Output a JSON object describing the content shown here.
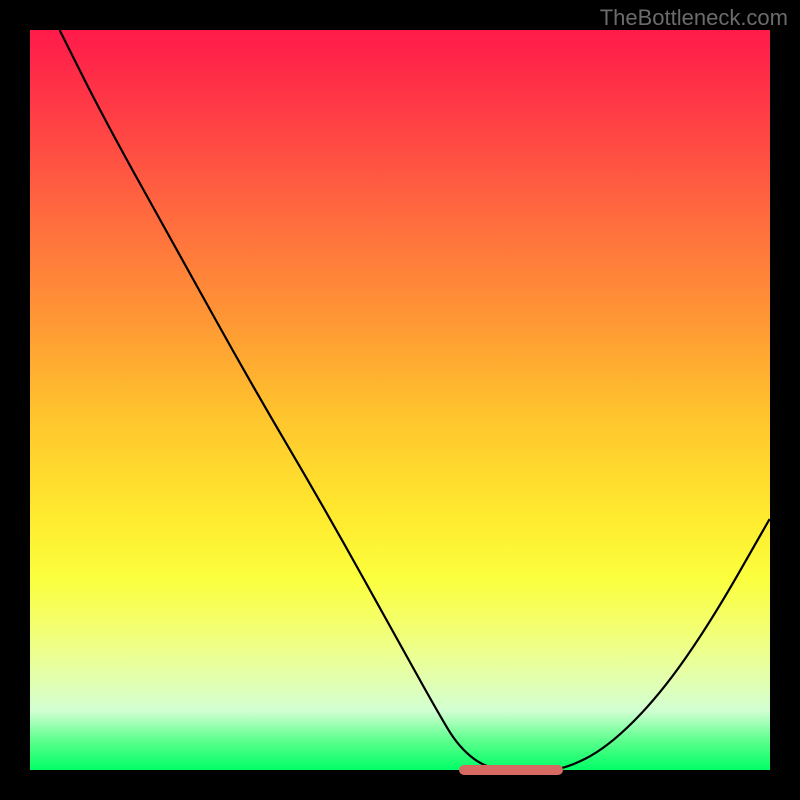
{
  "watermark": "TheBottleneck.com",
  "chart_data": {
    "type": "line",
    "title": "",
    "xlabel": "",
    "ylabel": "",
    "xlim": [
      0,
      100
    ],
    "ylim": [
      0,
      100
    ],
    "series": [
      {
        "name": "curve",
        "x": [
          4,
          10,
          20,
          30,
          40,
          50,
          55,
          58,
          62,
          68,
          72,
          78,
          85,
          92,
          100
        ],
        "values": [
          100,
          88,
          70,
          52,
          35,
          17,
          8,
          3,
          0,
          0,
          0,
          3,
          10,
          20,
          34
        ]
      }
    ],
    "min_region": {
      "x_start": 58,
      "x_end": 72,
      "y": 0
    },
    "marker_color": "#d66a62"
  }
}
